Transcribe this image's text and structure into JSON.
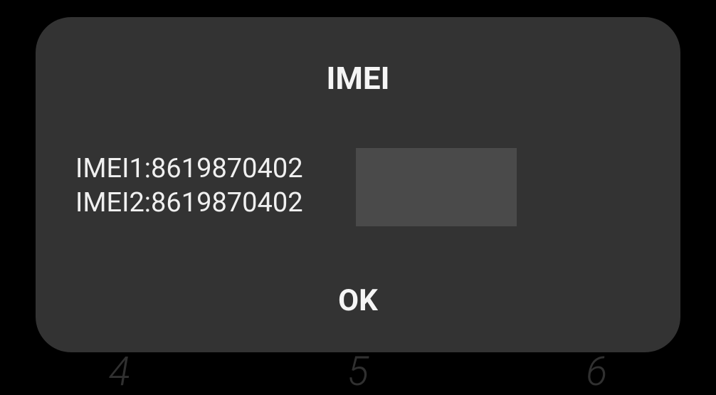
{
  "dialog": {
    "title": "IMEI",
    "imei1_label": "IMEI1:",
    "imei1_value": "8619870402",
    "imei2_label": "IMEI2:",
    "imei2_value": "8619870402",
    "ok_label": "OK"
  },
  "background": {
    "digit1": "4",
    "digit2": "5",
    "digit3": "6"
  }
}
